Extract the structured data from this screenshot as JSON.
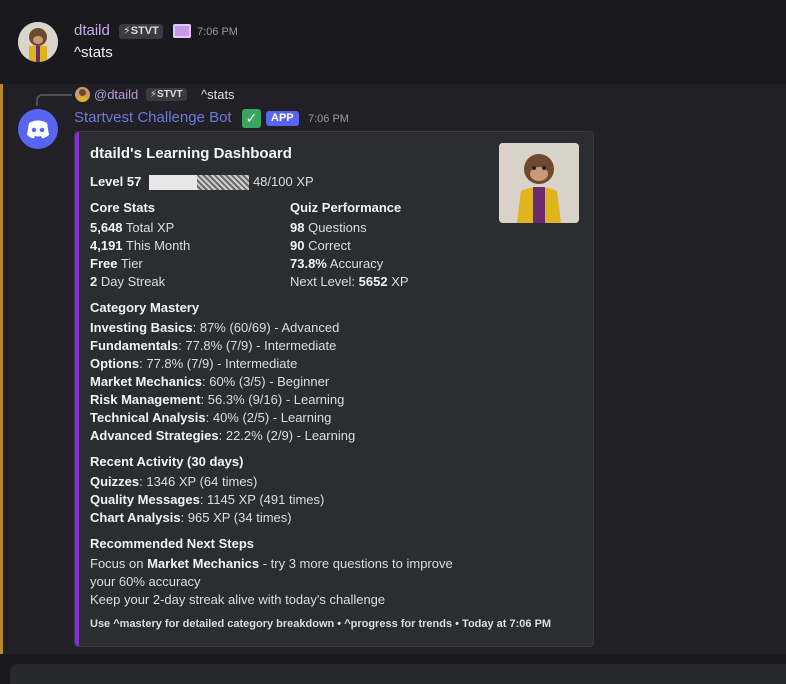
{
  "message1": {
    "author": "dtaild",
    "tag": "⚡STVT",
    "timestamp": "7:06 PM",
    "content": "^stats"
  },
  "message2": {
    "reply": {
      "author": "@dtaild",
      "tag": "⚡STVT",
      "content": "^stats"
    },
    "author": "Startvest Challenge Bot",
    "app_badge": "APP",
    "timestamp": "7:06 PM",
    "embed": {
      "title": "dtaild's Learning Dashboard",
      "level_label": "Level 57",
      "xp_progress": 0.48,
      "xp_text": "48/100 XP",
      "core_stats": {
        "heading": "Core Stats",
        "rows": [
          {
            "bold": "5,648",
            "rest": " Total XP"
          },
          {
            "bold": "4,191",
            "rest": " This Month"
          },
          {
            "bold": "Free",
            "rest": " Tier"
          },
          {
            "bold": "2",
            "rest": " Day Streak"
          }
        ]
      },
      "quiz": {
        "heading": "Quiz Performance",
        "rows": [
          {
            "bold": "98",
            "rest": " Questions"
          },
          {
            "bold": "90",
            "rest": " Correct"
          },
          {
            "bold": "73.8%",
            "rest": " Accuracy"
          }
        ],
        "next_level_label": "Next Level: ",
        "next_level_value": "5652",
        "next_level_unit": " XP"
      },
      "mastery": {
        "heading": "Category Mastery",
        "rows": [
          {
            "bold": "Investing Basics",
            "rest": ": 87% (60/69) - Advanced"
          },
          {
            "bold": "Fundamentals",
            "rest": ": 77.8% (7/9) - Intermediate"
          },
          {
            "bold": "Options",
            "rest": ": 77.8% (7/9) - Intermediate"
          },
          {
            "bold": "Market Mechanics",
            "rest": ": 60% (3/5) - Beginner"
          },
          {
            "bold": "Risk Management",
            "rest": ": 56.3% (9/16) - Learning"
          },
          {
            "bold": "Technical Analysis",
            "rest": ": 40% (2/5) - Learning"
          },
          {
            "bold": "Advanced Strategies",
            "rest": ": 22.2% (2/9) - Learning"
          }
        ]
      },
      "activity": {
        "heading": "Recent Activity (30 days)",
        "rows": [
          {
            "bold": "Quizzes",
            "rest": ": 1346 XP (64 times)"
          },
          {
            "bold": "Quality Messages",
            "rest": ": 1145 XP (491 times)"
          },
          {
            "bold": "Chart Analysis",
            "rest": ": 965 XP (34 times)"
          }
        ]
      },
      "next_steps": {
        "heading": "Recommended Next Steps",
        "line1_pre": "Focus on ",
        "line1_bold": "Market Mechanics",
        "line1_post": " - try 3 more questions to improve",
        "line2": "your 60% accuracy",
        "line3": "Keep your 2-day streak alive with today's challenge"
      },
      "footer": "Use ^mastery for detailed category breakdown • ^progress for trends • Today at 7:06 PM"
    }
  },
  "colors": {
    "accent": "#8a2be2",
    "author1": "#c9a8e8",
    "bot_name": "#6f7ad6",
    "mention_bar": "#b68a2a",
    "app_badge": "#5865f2"
  }
}
